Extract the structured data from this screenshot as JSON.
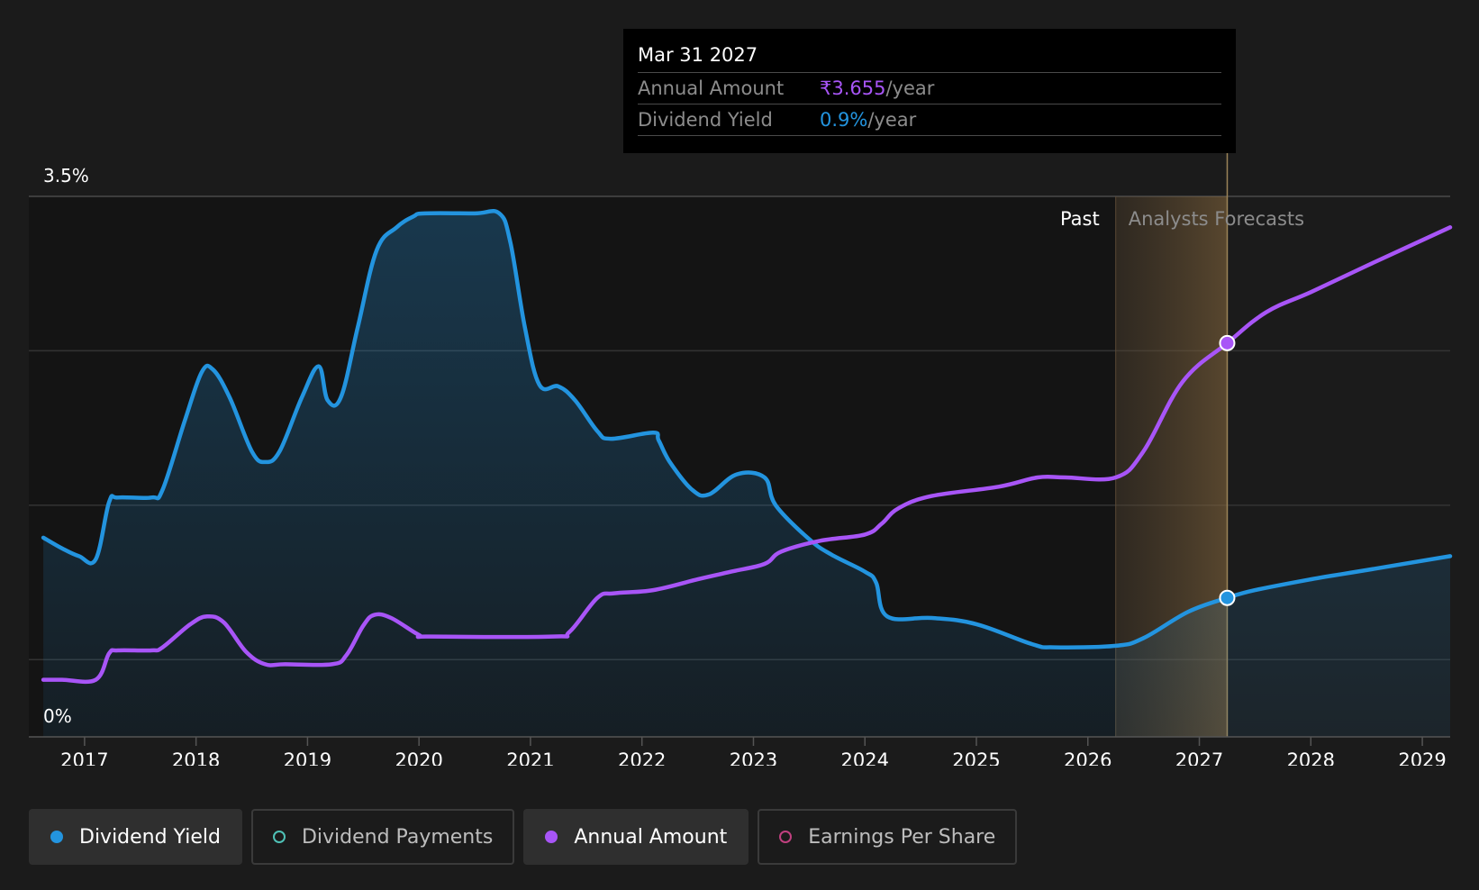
{
  "tooltip": {
    "date": "Mar 31 2027",
    "rows": [
      {
        "label": "Annual Amount",
        "value": "₹3.655",
        "unit": "/year",
        "color": "#a855f7"
      },
      {
        "label": "Dividend Yield",
        "value": "0.9%",
        "unit": "/year",
        "color": "#2394df"
      }
    ]
  },
  "legend": [
    {
      "label": "Dividend Yield",
      "color": "#2394df",
      "filled": true,
      "active": true
    },
    {
      "label": "Dividend Payments",
      "color": "#4fc1b6",
      "filled": false,
      "active": false
    },
    {
      "label": "Annual Amount",
      "color": "#a855f7",
      "filled": true,
      "active": true
    },
    {
      "label": "Earnings Per Share",
      "color": "#c0407f",
      "filled": false,
      "active": false
    }
  ],
  "chart_data": {
    "type": "line",
    "y_top_label": "3.5%",
    "y_bottom_label": "0%",
    "ylim": [
      0,
      3.5
    ],
    "xlim": [
      2016.5,
      2029.25
    ],
    "grid": true,
    "x_ticks": [
      "2017",
      "2018",
      "2019",
      "2020",
      "2021",
      "2022",
      "2023",
      "2024",
      "2025",
      "2026",
      "2027",
      "2028",
      "2029"
    ],
    "region_labels": {
      "past": "Past",
      "forecast": "Analysts Forecasts"
    },
    "past_end": 2026.25,
    "forecast_marker": 2027.25,
    "series": [
      {
        "name": "Dividend Yield",
        "color": "#2394df",
        "points": [
          [
            2016.63,
            1.29
          ],
          [
            2016.8,
            1.22
          ],
          [
            2016.95,
            1.17
          ],
          [
            2017.1,
            1.15
          ],
          [
            2017.22,
            1.52
          ],
          [
            2017.3,
            1.55
          ],
          [
            2017.6,
            1.55
          ],
          [
            2017.7,
            1.6
          ],
          [
            2017.9,
            2.05
          ],
          [
            2018.05,
            2.36
          ],
          [
            2018.15,
            2.38
          ],
          [
            2018.3,
            2.2
          ],
          [
            2018.5,
            1.85
          ],
          [
            2018.62,
            1.78
          ],
          [
            2018.75,
            1.85
          ],
          [
            2018.95,
            2.2
          ],
          [
            2019.1,
            2.4
          ],
          [
            2019.18,
            2.18
          ],
          [
            2019.3,
            2.2
          ],
          [
            2019.45,
            2.65
          ],
          [
            2019.62,
            3.15
          ],
          [
            2019.8,
            3.3
          ],
          [
            2019.95,
            3.37
          ],
          [
            2020.05,
            3.39
          ],
          [
            2020.5,
            3.39
          ],
          [
            2020.72,
            3.39
          ],
          [
            2020.82,
            3.2
          ],
          [
            2020.95,
            2.65
          ],
          [
            2021.08,
            2.28
          ],
          [
            2021.25,
            2.27
          ],
          [
            2021.4,
            2.18
          ],
          [
            2021.6,
            1.98
          ],
          [
            2021.72,
            1.93
          ],
          [
            2022.1,
            1.97
          ],
          [
            2022.15,
            1.92
          ],
          [
            2022.25,
            1.78
          ],
          [
            2022.45,
            1.6
          ],
          [
            2022.6,
            1.57
          ],
          [
            2022.85,
            1.7
          ],
          [
            2023.1,
            1.68
          ],
          [
            2023.2,
            1.5
          ],
          [
            2023.5,
            1.28
          ],
          [
            2023.7,
            1.18
          ],
          [
            2024.0,
            1.07
          ],
          [
            2024.1,
            1.0
          ],
          [
            2024.2,
            0.78
          ],
          [
            2024.6,
            0.77
          ],
          [
            2025.0,
            0.73
          ],
          [
            2025.5,
            0.6
          ],
          [
            2025.7,
            0.58
          ],
          [
            2026.25,
            0.59
          ],
          [
            2026.5,
            0.64
          ],
          [
            2026.9,
            0.81
          ],
          [
            2027.25,
            0.9
          ],
          [
            2027.5,
            0.95
          ],
          [
            2028.0,
            1.02
          ],
          [
            2028.5,
            1.08
          ],
          [
            2029.25,
            1.17
          ]
        ]
      },
      {
        "name": "Annual Amount",
        "color": "#a855f7",
        "points": [
          [
            2016.63,
            0.37
          ],
          [
            2016.8,
            0.37
          ],
          [
            2017.1,
            0.37
          ],
          [
            2017.22,
            0.54
          ],
          [
            2017.3,
            0.56
          ],
          [
            2017.6,
            0.56
          ],
          [
            2017.7,
            0.58
          ],
          [
            2017.95,
            0.73
          ],
          [
            2018.1,
            0.78
          ],
          [
            2018.25,
            0.74
          ],
          [
            2018.45,
            0.55
          ],
          [
            2018.62,
            0.47
          ],
          [
            2018.8,
            0.47
          ],
          [
            2019.22,
            0.47
          ],
          [
            2019.35,
            0.53
          ],
          [
            2019.5,
            0.72
          ],
          [
            2019.6,
            0.79
          ],
          [
            2019.75,
            0.77
          ],
          [
            2020.0,
            0.66
          ],
          [
            2020.1,
            0.65
          ],
          [
            2021.2,
            0.65
          ],
          [
            2021.35,
            0.68
          ],
          [
            2021.6,
            0.9
          ],
          [
            2021.75,
            0.93
          ],
          [
            2022.1,
            0.95
          ],
          [
            2022.5,
            1.02
          ],
          [
            2022.8,
            1.07
          ],
          [
            2023.1,
            1.12
          ],
          [
            2023.25,
            1.2
          ],
          [
            2023.6,
            1.27
          ],
          [
            2024.0,
            1.31
          ],
          [
            2024.15,
            1.38
          ],
          [
            2024.3,
            1.48
          ],
          [
            2024.6,
            1.56
          ],
          [
            2025.2,
            1.62
          ],
          [
            2025.55,
            1.68
          ],
          [
            2025.8,
            1.68
          ],
          [
            2026.25,
            1.68
          ],
          [
            2026.5,
            1.85
          ],
          [
            2026.85,
            2.3
          ],
          [
            2027.25,
            2.55
          ],
          [
            2027.6,
            2.75
          ],
          [
            2028.0,
            2.88
          ],
          [
            2028.5,
            3.05
          ],
          [
            2029.25,
            3.3
          ]
        ]
      }
    ]
  }
}
